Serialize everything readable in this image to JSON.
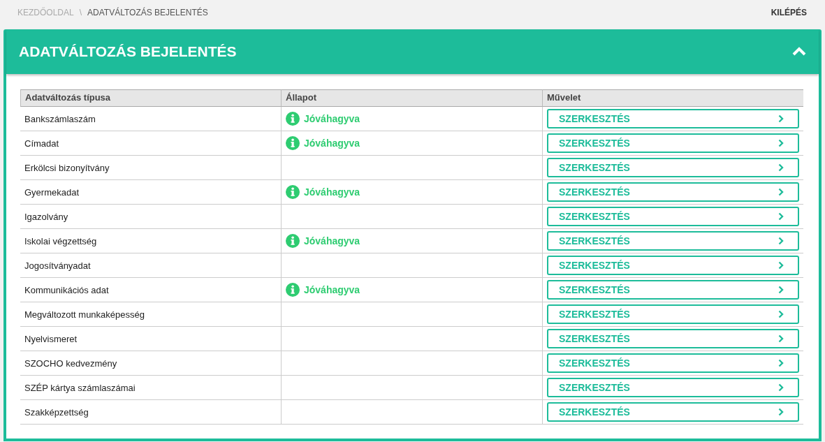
{
  "breadcrumb": [
    {
      "label": "KEZDŐOLDAL",
      "current": false
    },
    {
      "label": "ADATVÁLTOZÁS BEJELENTÉS",
      "current": true
    }
  ],
  "breadcrumb_separator": "\\",
  "logout": "KILÉPÉS",
  "panel": {
    "title": "ADATVÁLTOZÁS BEJELENTÉS",
    "expanded": true
  },
  "table": {
    "columns": [
      "Adatváltozás típusa",
      "Állapot",
      "Művelet"
    ],
    "rows": [
      {
        "type": "Bankszámlaszám",
        "status": "Jóváhagyva",
        "action": "SZERKESZTÉS"
      },
      {
        "type": "Címadat",
        "status": "Jóváhagyva",
        "action": "SZERKESZTÉS"
      },
      {
        "type": "Erkölcsi bizonyítvány",
        "action": "SZERKESZTÉS"
      },
      {
        "type": "Gyermekadat",
        "status": "Jóváhagyva",
        "action": "SZERKESZTÉS"
      },
      {
        "type": "Igazolvány",
        "action": "SZERKESZTÉS"
      },
      {
        "type": "Iskolai végzettség",
        "status": "Jóváhagyva",
        "action": "SZERKESZTÉS"
      },
      {
        "type": "Jogosítványadat",
        "action": "SZERKESZTÉS"
      },
      {
        "type": "Kommunikációs adat",
        "status": "Jóváhagyva",
        "action": "SZERKESZTÉS"
      },
      {
        "type": "Megváltozott munkaképesség",
        "action": "SZERKESZTÉS"
      },
      {
        "type": "Nyelvismeret",
        "action": "SZERKESZTÉS"
      },
      {
        "type": "SZOCHO kedvezmény",
        "action": "SZERKESZTÉS"
      },
      {
        "type": "SZÉP kártya számlaszámai",
        "action": "SZERKESZTÉS"
      },
      {
        "type": "Szakképzettség",
        "action": "SZERKESZTÉS"
      }
    ]
  }
}
